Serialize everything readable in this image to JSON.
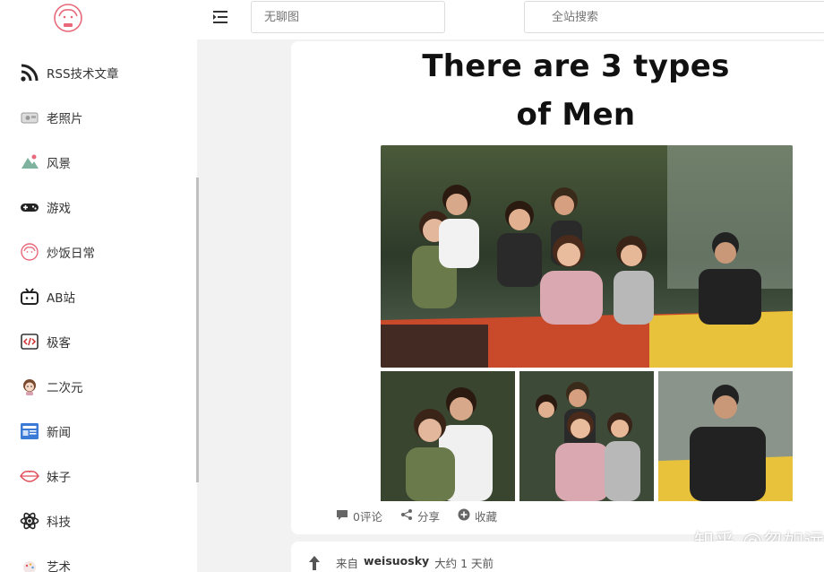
{
  "sidebar": {
    "logo_icon": "sheep-logo-icon",
    "items": [
      {
        "label": "RSS技术文章",
        "icon": "rss-icon"
      },
      {
        "label": "老照片",
        "icon": "old-photo-icon"
      },
      {
        "label": "风景",
        "icon": "landscape-icon"
      },
      {
        "label": "游戏",
        "icon": "gamepad-icon"
      },
      {
        "label": "炒饭日常",
        "icon": "sheep-icon"
      },
      {
        "label": "AB站",
        "icon": "bilibili-tv-icon"
      },
      {
        "label": "极客",
        "icon": "code-icon"
      },
      {
        "label": "二次元",
        "icon": "anime-girl-icon"
      },
      {
        "label": "新闻",
        "icon": "newspaper-icon"
      },
      {
        "label": "妹子",
        "icon": "lips-icon"
      },
      {
        "label": "科技",
        "icon": "atom-icon"
      },
      {
        "label": "艺术",
        "icon": "art-icon"
      }
    ]
  },
  "topbar": {
    "menu_icon": "menu-indent-icon",
    "chat_placeholder": "无聊图",
    "search_placeholder": "全站搜索"
  },
  "post": {
    "meme_title_line1": "There are 3 types",
    "meme_title_line2": "of Men",
    "comment_label": "0评论",
    "share_label": "分享",
    "favorite_label": "收藏"
  },
  "watermark": "知乎 @忽如远行客",
  "next_post": {
    "from_label": "来自",
    "username": "weisuosky",
    "time": "大约 1 天前"
  },
  "colors": {
    "sidebar_bg": "#ffffff",
    "page_bg": "#f2f2f2",
    "logo_pink": "#e86a7a"
  }
}
